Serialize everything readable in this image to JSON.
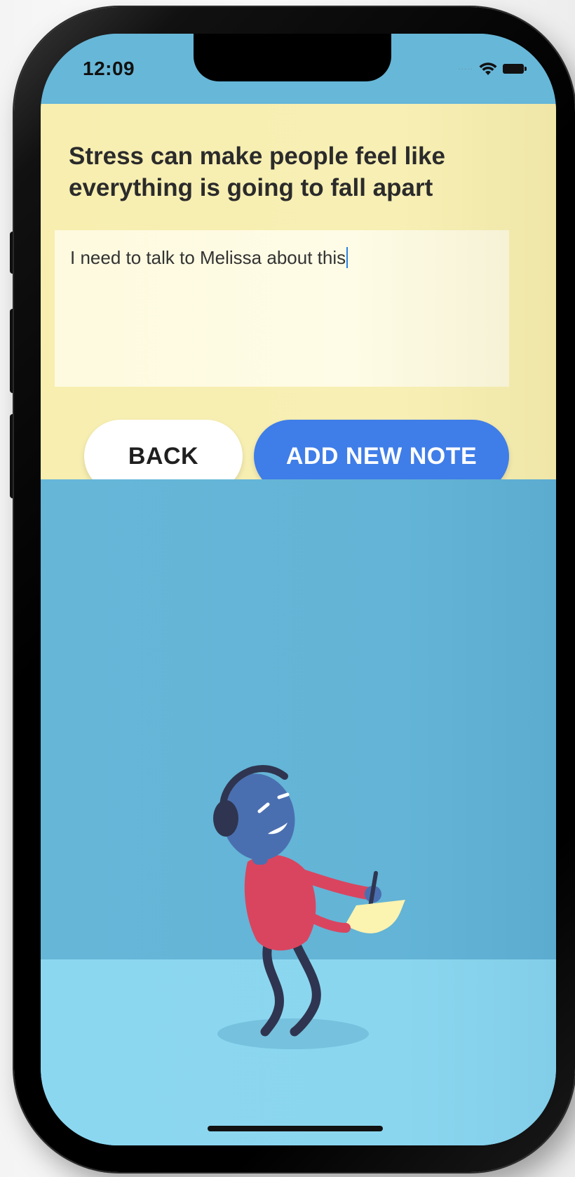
{
  "status_bar": {
    "time": "12:09",
    "signal_icon": "signal-dots-icon",
    "wifi_icon": "wifi-icon",
    "battery_icon": "battery-icon"
  },
  "note": {
    "prompt": "Stress can make people feel like everything is going to fall apart",
    "input_value": "I need to talk to Melissa about this"
  },
  "actions": {
    "back_label": "BACK",
    "add_label": "ADD NEW NOTE"
  },
  "colors": {
    "status_bar_bg": "#67b7d8",
    "panel_bg": "#f7eeb0",
    "input_bg": "#fefce6",
    "primary_button": "#3f7de8",
    "scene_bg": "#63b4d6",
    "floor_bg": "#8bd6ef",
    "character_sweater": "#d9455f",
    "character_skin": "#4a6fb0",
    "character_legs": "#2f3550"
  },
  "illustration": {
    "name": "person-writing-note-illustration"
  }
}
